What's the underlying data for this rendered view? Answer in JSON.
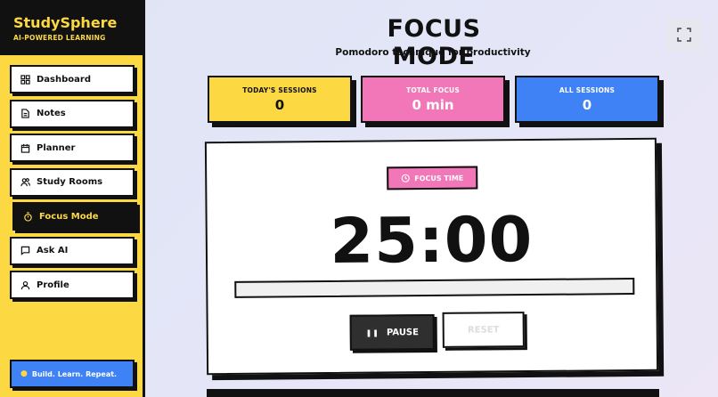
{
  "brand": {
    "title": "StudySphere",
    "subtitle": "AI-POWERED LEARNING"
  },
  "sidebar": {
    "items": [
      {
        "label": "Dashboard",
        "icon": "grid-icon"
      },
      {
        "label": "Notes",
        "icon": "document-icon"
      },
      {
        "label": "Planner",
        "icon": "calendar-icon"
      },
      {
        "label": "Study Rooms",
        "icon": "users-icon"
      },
      {
        "label": "Focus Mode",
        "icon": "timer-icon",
        "active": true
      },
      {
        "label": "Ask AI",
        "icon": "chat-icon"
      },
      {
        "label": "Profile",
        "icon": "user-icon"
      }
    ],
    "footer": "Build. Learn. Repeat."
  },
  "header": {
    "title": "FOCUS MODE",
    "subtitle": "Pomodoro technique for productivity"
  },
  "stats": [
    {
      "label": "TODAY'S SESSIONS",
      "value": "0"
    },
    {
      "label": "TOTAL FOCUS",
      "value": "0 min"
    },
    {
      "label": "ALL SESSIONS",
      "value": "0"
    }
  ],
  "timer": {
    "mode_label": "FOCUS TIME",
    "time": "25:00",
    "progress": 0,
    "pause_label": "PAUSE",
    "reset_label": "RESET"
  },
  "colors": {
    "yellow": "#fcd843",
    "pink": "#f277b8",
    "blue": "#3f82f5",
    "dark": "#111111"
  }
}
